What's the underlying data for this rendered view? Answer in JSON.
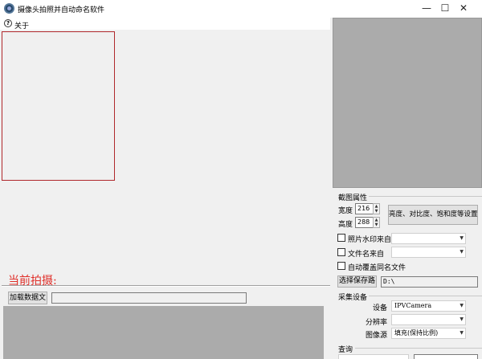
{
  "window": {
    "title": "摄像头拍照并自动命名软件",
    "minimize_glyph": "—",
    "maximize_glyph": "☐",
    "close_glyph": "✕",
    "icon": "camera-app-icon"
  },
  "menu": {
    "about_icon_glyph": "?",
    "about_label": "关于"
  },
  "main": {
    "current_capture_label": "当前拍摄:",
    "load_data_button": "加载数据文",
    "load_path_value": ""
  },
  "crop": {
    "title": "截图属性",
    "width_label": "宽度",
    "width_value": "216",
    "height_label": "高度",
    "height_value": "288",
    "adjust_button": "亮度、对比度、饱和度等设置"
  },
  "options": {
    "watermark_label": "照片水印来自",
    "watermark_checked": false,
    "watermark_value": "",
    "filename_label": "文件名来自",
    "filename_checked": false,
    "filename_value": "",
    "overwrite_label": "自动覆盖同名文件",
    "overwrite_checked": false
  },
  "save": {
    "button": "选择保存路",
    "path": "D:\\"
  },
  "capture": {
    "title": "采集设备",
    "device_label": "设备",
    "device_value": "IPVCamera",
    "resolution_label": "分辨率",
    "resolution_value": "",
    "source_label": "图像源",
    "source_value": "填充(保持比例)"
  },
  "query": {
    "title": "查询"
  }
}
